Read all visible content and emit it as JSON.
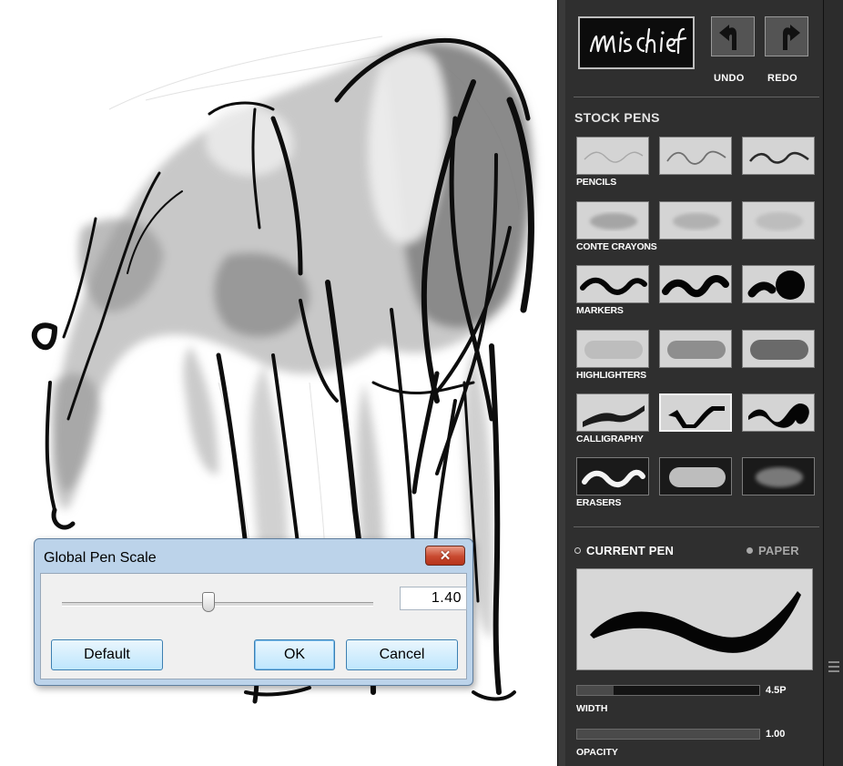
{
  "app": {
    "logo_text": "mischief"
  },
  "history": {
    "undo_label": "UNDO",
    "redo_label": "REDO"
  },
  "stock_pens": {
    "title": "STOCK PENS",
    "groups": [
      {
        "label": "PENCILS",
        "pens": [
          "light",
          "light",
          "light"
        ]
      },
      {
        "label": "CONTE CRAYONS",
        "pens": [
          "light",
          "light",
          "light"
        ]
      },
      {
        "label": "MARKERS",
        "pens": [
          "light",
          "light",
          "light"
        ]
      },
      {
        "label": "HIGHLIGHTERS",
        "pens": [
          "light",
          "light",
          "light"
        ]
      },
      {
        "label": "CALLIGRAPHY",
        "pens": [
          "light",
          "light-selected",
          "light"
        ]
      },
      {
        "label": "ERASERS",
        "pens": [
          "dark",
          "dark",
          "dark"
        ]
      }
    ]
  },
  "current_pen": {
    "tab_current": "CURRENT PEN",
    "tab_paper": "PAPER",
    "width_label": "WIDTH",
    "width_value": "4.5P",
    "width_fraction": 0.2,
    "opacity_label": "OPACITY",
    "opacity_value": "1.00",
    "opacity_fraction": 1.0
  },
  "dialog": {
    "title": "Global Pen Scale",
    "close_symbol": "✕",
    "scale_value": "1.40",
    "slider_fraction": 0.47,
    "default_label": "Default",
    "ok_label": "OK",
    "cancel_label": "Cancel"
  },
  "colors": {
    "panel_bg": "#2f2f2f",
    "canvas_bg": "#ffffff",
    "dialog_frame": "#bcd3ea",
    "close_red": "#c8492f",
    "button_border": "#3c7fb1"
  },
  "icons": [
    "undo-arrow-icon",
    "redo-arrow-icon",
    "close-icon"
  ]
}
